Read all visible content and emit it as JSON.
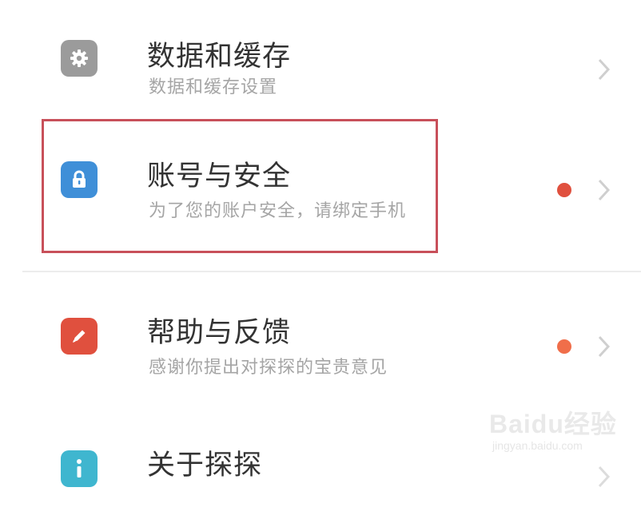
{
  "settings_list": {
    "items": [
      {
        "title": "数据和缓存",
        "subtitle": "数据和缓存设置",
        "icon": "gear-icon",
        "icon_color": "#9b9b9b",
        "has_dot": false
      },
      {
        "title": "账号与安全",
        "subtitle": "为了您的账户安全，请绑定手机",
        "icon": "lock-icon",
        "icon_color": "#3f8fd8",
        "has_dot": true,
        "dot_color": "#e0503e",
        "highlighted": true
      },
      {
        "title": "帮助与反馈",
        "subtitle": "感谢你提出对探探的宝贵意见",
        "icon": "pencil-icon",
        "icon_color": "#e0503e",
        "has_dot": true,
        "dot_color": "#f06e4a"
      },
      {
        "title": "关于探探",
        "subtitle": "",
        "icon": "info-icon",
        "icon_color": "#3fb6cf",
        "has_dot": false
      }
    ]
  },
  "highlight_color": "#c8505a",
  "watermark": {
    "logo": "Baidu经验",
    "url": "jingyan.baidu.com"
  }
}
